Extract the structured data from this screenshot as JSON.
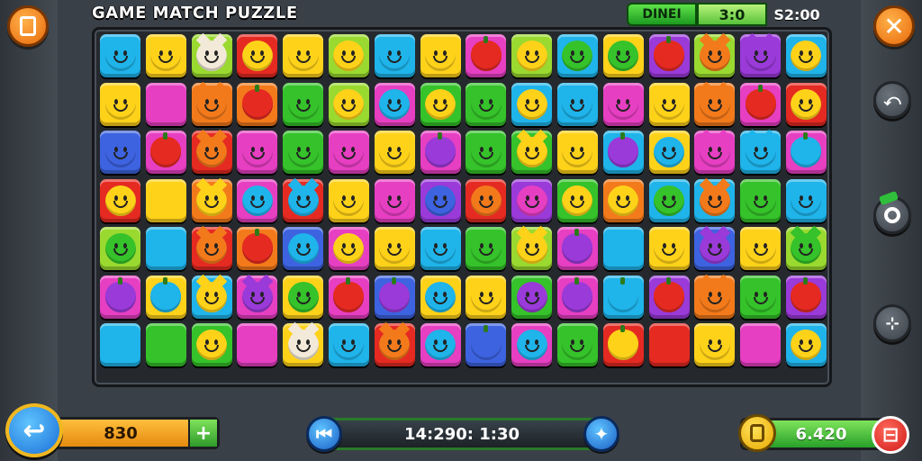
{
  "game": {
    "title": "GAME MATCH PUZZLE"
  },
  "hud": {
    "label": "DINEI",
    "moves": "3:0",
    "timer": "S2:00"
  },
  "bottom": {
    "score": "830",
    "time": "14:290: 1:30",
    "coins": "6.420"
  },
  "icons": {
    "menu": "menu-icon",
    "close": "close-icon",
    "back": "back-arrow-icon",
    "add": "plus-icon",
    "prev": "rewind-icon",
    "next": "star-icon",
    "bag": "bag-icon",
    "exit": "exit-icon"
  },
  "palette": {
    "R": "#e52a22",
    "O": "#f37a1b",
    "Y": "#ffd21a",
    "G": "#35c22a",
    "C": "#1fb4ea",
    "P": "#9a3ad9",
    "M": "#e63fc2",
    "B": "#3d63e0",
    "L": "#9ad92f",
    "W": "#f2e9d8"
  },
  "board": {
    "rows": [
      [
        "C:C:face",
        "Y:Y:face",
        "L:W:cat",
        "R:Y:face",
        "Y:Y:face",
        "L:Y:face",
        "C:C:face",
        "Y:Y:face",
        "M:R:fruit",
        "L:Y:face",
        "C:G:face",
        "Y:G:face",
        "P:R:fruit",
        "L:O:cat",
        "P:P:cat",
        "C:Y:face"
      ],
      [
        "Y:Y:face",
        "M:M:none",
        "O:O:cat",
        "O:R:fruit",
        "G:G:face",
        "L:Y:face",
        "M:C:face",
        "G:Y:face",
        "G:G:face",
        "C:Y:face",
        "C:C:face",
        "M:M:face",
        "Y:Y:face",
        "O:O:cat",
        "M:R:fruit",
        "R:Y:face"
      ],
      [
        "B:B:face",
        "M:R:fruit",
        "R:O:cat",
        "M:M:face",
        "G:G:face",
        "M:M:face",
        "Y:Y:face",
        "M:P:fruit",
        "G:G:face",
        "G:Y:cat",
        "Y:Y:face",
        "C:P:fruit",
        "Y:C:face",
        "M:M:cat",
        "C:C:cat",
        "M:C:fruit"
      ],
      [
        "R:Y:face",
        "Y:Y:none",
        "O:Y:cat",
        "M:C:face",
        "R:C:cat",
        "Y:Y:face",
        "M:M:face",
        "P:B:face",
        "R:O:face",
        "P:M:face",
        "G:Y:face",
        "O:Y:face",
        "C:G:face",
        "C:O:cat",
        "G:G:face",
        "C:C:face"
      ],
      [
        "L:G:face",
        "C:C:none",
        "R:O:cat",
        "O:R:fruit",
        "B:C:face",
        "M:Y:face",
        "Y:Y:face",
        "C:C:face",
        "G:G:face",
        "L:Y:cat",
        "M:P:fruit",
        "C:C:none",
        "Y:Y:face",
        "B:P:cat",
        "Y:Y:face",
        "L:G:cat"
      ],
      [
        "M:P:fruit",
        "Y:C:fruit",
        "C:Y:cat",
        "M:P:cat",
        "Y:G:face",
        "M:R:fruit",
        "B:P:fruit",
        "Y:C:face",
        "Y:Y:face",
        "G:P:face",
        "M:P:fruit",
        "C:C:fruit",
        "P:R:fruit",
        "O:O:cat",
        "G:G:face",
        "P:R:fruit"
      ],
      [
        "C:C:none",
        "G:G:none",
        "G:Y:face",
        "M:M:none",
        "Y:W:cat",
        "C:C:face",
        "R:O:cat",
        "M:C:face",
        "B:B:fruit",
        "M:C:face",
        "G:G:face",
        "R:Y:fruit",
        "R:R:none",
        "Y:Y:face",
        "M:M:none",
        "C:Y:face"
      ]
    ]
  }
}
